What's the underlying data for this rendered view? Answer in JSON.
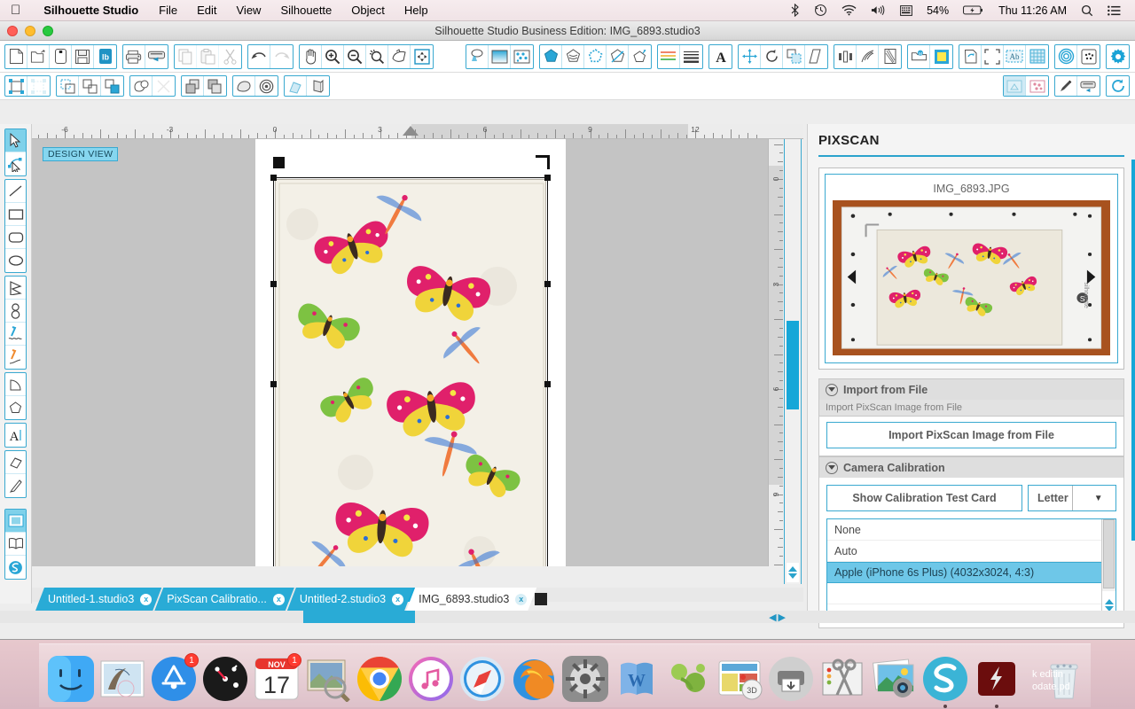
{
  "menubar": {
    "apple": "apple-logo",
    "app_name": "Silhouette Studio",
    "items": [
      "File",
      "Edit",
      "View",
      "Silhouette",
      "Object",
      "Help"
    ],
    "status": {
      "bluetooth": "bluetooth-icon",
      "timemachine": "time-machine-icon",
      "wifi": "wifi-icon",
      "volume": "volume-icon",
      "keyboard": "input-menu-icon",
      "battery_percent": "54%",
      "battery": "battery-charging-icon",
      "clock": "Thu 11:26 AM",
      "spotlight": "search-icon",
      "notifications": "notification-center-icon"
    }
  },
  "window": {
    "title": "Silhouette Studio Business Edition: IMG_6893.studio3"
  },
  "toolbar_top": {
    "groups": [
      {
        "name": "file",
        "buttons": [
          "new-document",
          "open-document",
          "save-as-page",
          "save-document",
          "save-library"
        ]
      },
      {
        "name": "send",
        "buttons": [
          "print",
          "send-to-silhouette"
        ]
      },
      {
        "name": "clipboard",
        "buttons": [
          "copy",
          "paste",
          "cut"
        ]
      },
      {
        "name": "history",
        "buttons": [
          "undo",
          "redo"
        ]
      },
      {
        "name": "view",
        "buttons": [
          "pan",
          "zoom-in",
          "zoom-out",
          "zoom-selection",
          "zoom-region",
          "fit-to-window"
        ]
      },
      {
        "name": "fill",
        "buttons": [
          "fill-color",
          "fill-gradient",
          "fill-pattern"
        ]
      },
      {
        "name": "shape-ops",
        "buttons": [
          "offset",
          "trace",
          "modify",
          "knife",
          "warp"
        ]
      },
      {
        "name": "line",
        "buttons": [
          "line-color",
          "line-style"
        ]
      },
      {
        "name": "text",
        "buttons": [
          "text-style"
        ]
      },
      {
        "name": "transform",
        "buttons": [
          "move",
          "rotate",
          "scale",
          "shear"
        ]
      },
      {
        "name": "align",
        "buttons": [
          "align",
          "replicate",
          "nesting"
        ]
      },
      {
        "name": "page-setup",
        "buttons": [
          "page-setup",
          "cut-settings"
        ]
      },
      {
        "name": "layout",
        "buttons": [
          "rotate-page",
          "registration-marks",
          "auto-fill",
          "grid"
        ]
      },
      {
        "name": "special",
        "buttons": [
          "spiral",
          "stipple"
        ]
      },
      {
        "name": "prefs",
        "buttons": [
          "preferences"
        ]
      }
    ]
  },
  "toolbar_second": {
    "groups": [
      {
        "name": "select",
        "buttons": [
          "select-all",
          "deselect-all"
        ]
      },
      {
        "name": "group",
        "buttons": [
          "group",
          "ungroup",
          "make-compound"
        ]
      },
      {
        "name": "weld",
        "buttons": [
          "weld",
          "detach"
        ]
      },
      {
        "name": "arrange",
        "buttons": [
          "bring-to-front",
          "send-to-back"
        ]
      },
      {
        "name": "modify",
        "buttons": [
          "modify-shape",
          "offset-shape"
        ]
      },
      {
        "name": "edit",
        "buttons": [
          "eraser-tool",
          "release-compound"
        ]
      }
    ],
    "right_groups": [
      {
        "name": "pixscan-view",
        "buttons": [
          "design-page",
          "pixscan-page"
        ]
      },
      {
        "name": "send-panel",
        "buttons": [
          "pen-holder",
          "send-to-cutter"
        ]
      },
      {
        "name": "sync",
        "buttons": [
          "refresh-sync"
        ]
      }
    ]
  },
  "tool_rail": {
    "items": [
      {
        "name": "select-tool",
        "selected": true
      },
      {
        "name": "edit-points-tool",
        "selected": false
      },
      {
        "name": "line-tool",
        "selected": false
      },
      {
        "name": "rectangle-tool",
        "selected": false
      },
      {
        "name": "rounded-rectangle-tool",
        "selected": false
      },
      {
        "name": "ellipse-tool",
        "selected": false
      },
      {
        "name": "polygon-tool",
        "selected": false
      },
      {
        "name": "curve-tool",
        "selected": false
      },
      {
        "name": "draw-smooth-tool",
        "selected": false
      },
      {
        "name": "freehand-tool",
        "selected": false
      },
      {
        "name": "arc-tool",
        "selected": false
      },
      {
        "name": "regular-polygon-tool",
        "selected": false
      },
      {
        "name": "text-tool",
        "selected": false
      },
      {
        "name": "eraser-tool",
        "selected": false
      },
      {
        "name": "knife-tool",
        "selected": false
      },
      {
        "name": "design-page-tool",
        "selected": true
      },
      {
        "name": "library-tool",
        "selected": false
      },
      {
        "name": "store-tool",
        "selected": false
      }
    ]
  },
  "canvas": {
    "badge": "DESIGN VIEW",
    "ruler_h_labels": [
      "-6",
      "-3",
      "0",
      "3",
      "6",
      "9",
      "12"
    ],
    "ruler_v_labels": [
      "0",
      "3",
      "6",
      "9"
    ],
    "units": "inches"
  },
  "panel": {
    "title": "PIXSCAN",
    "preview": {
      "filename": "IMG_6893.JPG",
      "watermark": "silhouette"
    },
    "import_section": {
      "heading": "Import from File",
      "sublabel": "Import PixScan Image from File",
      "button": "Import PixScan Image from File"
    },
    "calibration_section": {
      "heading": "Camera Calibration",
      "button": "Show Calibration Test Card",
      "paper_size": "Letter",
      "camera_list": [
        {
          "label": "None",
          "selected": false
        },
        {
          "label": "Auto",
          "selected": false
        },
        {
          "label": "Apple (iPhone 6s Plus) (4032x3024, 4:3)",
          "selected": true
        }
      ]
    }
  },
  "tabs": [
    {
      "label": "Untitled-1.studio3",
      "close": "x",
      "active": false
    },
    {
      "label": "PixScan Calibratio...",
      "close": "x",
      "active": false
    },
    {
      "label": "Untitled-2.studio3",
      "close": "x",
      "active": false
    },
    {
      "label": "IMG_6893.studio3",
      "close": "x",
      "active": true
    }
  ],
  "dock": {
    "items": [
      {
        "name": "finder",
        "badge": ""
      },
      {
        "name": "mail",
        "badge": ""
      },
      {
        "name": "app-store",
        "badge": "1"
      },
      {
        "name": "dashboard",
        "badge": ""
      },
      {
        "name": "calendar",
        "badge": "1",
        "month": "NOV",
        "day": "17"
      },
      {
        "name": "preview",
        "badge": ""
      },
      {
        "name": "google-chrome",
        "badge": ""
      },
      {
        "name": "itunes",
        "badge": ""
      },
      {
        "name": "safari",
        "badge": ""
      },
      {
        "name": "firefox",
        "badge": ""
      },
      {
        "name": "system-preferences",
        "badge": ""
      },
      {
        "name": "microsoft-word",
        "badge": ""
      },
      {
        "name": "sketchup",
        "badge": ""
      },
      {
        "name": "sketchup-layout",
        "badge": ""
      },
      {
        "name": "printer",
        "badge": ""
      },
      {
        "name": "snipping-tool",
        "badge": ""
      },
      {
        "name": "photos",
        "badge": ""
      },
      {
        "name": "silhouette-studio",
        "badge": ""
      },
      {
        "name": "flash-player",
        "badge": ""
      },
      {
        "name": "trash",
        "badge": ""
      }
    ],
    "desktop_file_lines": [
      "k editin",
      "odate.pd"
    ]
  }
}
